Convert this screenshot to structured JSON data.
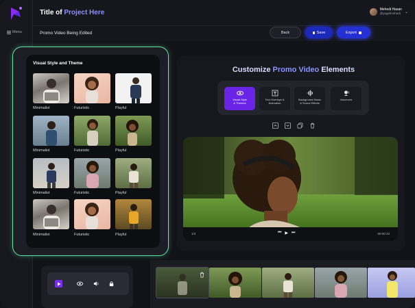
{
  "app": {
    "title_prefix": "Title of ",
    "title_accent": "Project Here",
    "menu_label": "Menu"
  },
  "user": {
    "name": "Mehedi Hasan",
    "handle": "@yagelmehedi"
  },
  "subbar": {
    "status": "Promo Video Being Edited",
    "back_label": "Back",
    "save_label": "Save",
    "export_label": "Export"
  },
  "theme_panel": {
    "heading": "Visual Style and Theme",
    "labels": [
      "Minimalist",
      "Futuristic",
      "Playful"
    ]
  },
  "editor": {
    "title_prefix": "Customize ",
    "title_accent": "Promo Video",
    "title_suffix": " Elements",
    "tools": [
      {
        "label1": "Visual Style",
        "label2": "& Themes",
        "icon": "eye-icon",
        "active": true
      },
      {
        "label1": "Text Overlays &",
        "label2": "Animation",
        "icon": "text-icon",
        "active": false
      },
      {
        "label1": "Background Music",
        "label2": "& Sound Effects",
        "icon": "waveform-icon",
        "active": false
      },
      {
        "label1": "Voiceover",
        "label2": "",
        "icon": "voice-icon",
        "active": false
      }
    ]
  },
  "player": {
    "left_label": "1/4",
    "time": "00:00:10"
  },
  "colors": {
    "accent": "#6a24e8",
    "primary_blue": "#2430d4",
    "frame_green": "#5fe8a4"
  }
}
